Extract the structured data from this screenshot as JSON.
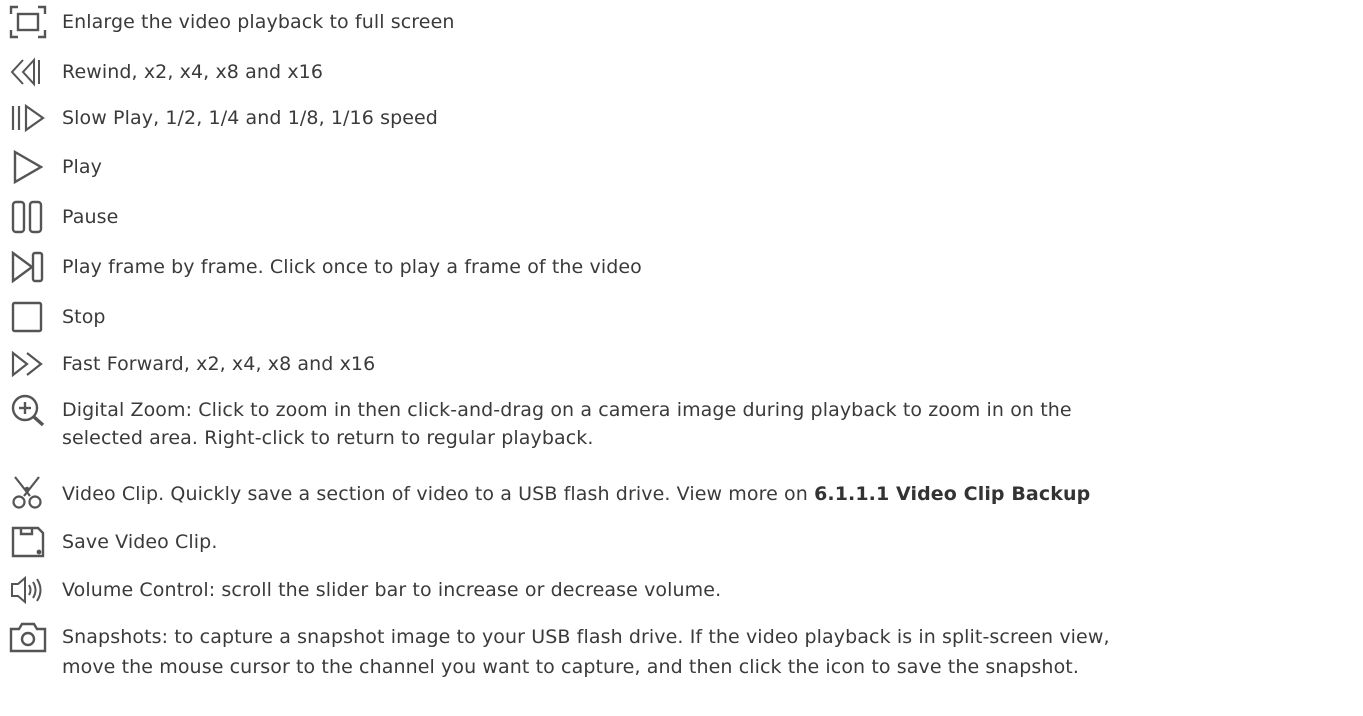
{
  "items": [
    {
      "icon": "fullscreen-icon",
      "text": "Enlarge the video playback to full screen"
    },
    {
      "icon": "rewind-icon",
      "text": "Rewind, x2, x4, x8 and x16"
    },
    {
      "icon": "slow-play-icon",
      "text": "Slow Play, 1/2, 1/4 and 1/8, 1/16 speed"
    },
    {
      "icon": "play-icon",
      "text": "Play"
    },
    {
      "icon": "pause-icon",
      "text": "Pause"
    },
    {
      "icon": "frame-by-frame-icon",
      "text": "Play frame by frame. Click once to play a frame of the video"
    },
    {
      "icon": "stop-icon",
      "text": "Stop"
    },
    {
      "icon": "fast-forward-icon",
      "text": "Fast Forward, x2, x4, x8 and x16"
    },
    {
      "icon": "zoom-in-icon",
      "text": "Digital Zoom: Click to zoom in then click-and-drag on a camera image during playback to zoom in on the",
      "text2": "selected area. Right-click to return to regular playback."
    },
    {
      "icon": "scissors-icon",
      "text": "Video Clip. Quickly save a section of video to a USB flash drive. View more on ",
      "link": "6.1.1.1 Video Clip Backup"
    },
    {
      "icon": "save-icon",
      "text": "Save Video Clip."
    },
    {
      "icon": "volume-icon",
      "text": "Volume Control: scroll the slider bar to increase or decrease volume."
    },
    {
      "icon": "camera-icon",
      "text": "Snapshots: to capture a snapshot image to your USB flash drive. If the video playback is in split-screen view,",
      "text2": "move the mouse cursor to the channel you want to capture, and then click the icon to save the snapshot."
    }
  ],
  "colors": {
    "icon": "#555555",
    "text": "#3a3a3a"
  }
}
